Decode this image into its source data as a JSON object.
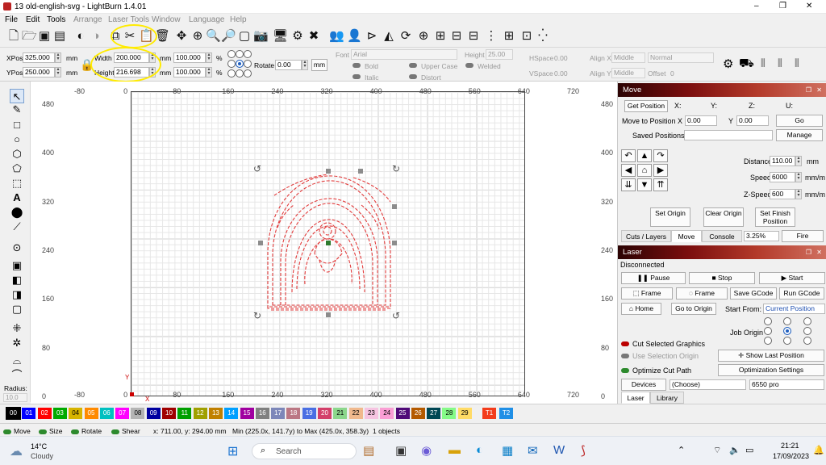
{
  "window": {
    "title": "13 old-english-svg - LightBurn 1.4.01",
    "controls": {
      "min": "–",
      "max": "❐",
      "close": "✕"
    }
  },
  "menu": [
    {
      "label": "File",
      "enabled": true
    },
    {
      "label": "Edit",
      "enabled": true
    },
    {
      "label": "Tools",
      "enabled": true
    },
    {
      "label": "Arrange",
      "enabled": false
    },
    {
      "label": "Laser Tools",
      "enabled": false
    },
    {
      "label": "Window",
      "enabled": false
    },
    {
      "label": "Language",
      "enabled": false
    },
    {
      "label": "Help",
      "enabled": false
    }
  ],
  "props": {
    "xpos_label": "XPos",
    "xpos": "325.000",
    "ypos_label": "YPos",
    "ypos": "250.000",
    "unit": "mm",
    "width_label": "Width",
    "width": "200.000",
    "height_label": "Height",
    "height": "216.698",
    "wpct": "100.000",
    "hpct": "100.000",
    "pct": "%",
    "rotate_label": "Rotate",
    "rotate": "0.00",
    "font_label": "Font",
    "font": "Arial",
    "font_height_label": "Height",
    "font_height": "25.00",
    "hspace_label": "HSpace",
    "hspace": "0.00",
    "vspace_label": "VSpace",
    "vspace": "0.00",
    "alignx_label": "Align X",
    "alignx": "Middle",
    "aligny_label": "Align Y",
    "aligny": "Middle",
    "normal": "Normal",
    "offset_label": "Offset",
    "offset": "0",
    "bold": "Bold",
    "italic": "Italic",
    "upper": "Upper Case",
    "distort": "Distort",
    "welded": "Welded"
  },
  "rulers": {
    "top": [
      "-80",
      "0",
      "80",
      "160",
      "240",
      "320",
      "400",
      "480",
      "560",
      "640",
      "720"
    ],
    "bottom": [
      "-80",
      "0",
      "80",
      "160",
      "240",
      "320",
      "400",
      "480",
      "560",
      "640",
      "720"
    ],
    "left": [
      "480",
      "400",
      "320",
      "240",
      "160",
      "80",
      "0"
    ],
    "right": [
      "480",
      "400",
      "320",
      "240",
      "160",
      "80",
      "0"
    ]
  },
  "left_tools": {
    "radius_label": "Radius:",
    "radius": "10.0"
  },
  "palette": [
    {
      "id": "00",
      "color": "#000000"
    },
    {
      "id": "01",
      "color": "#0000ff"
    },
    {
      "id": "02",
      "color": "#ff0000"
    },
    {
      "id": "03",
      "color": "#00aa00"
    },
    {
      "id": "04",
      "color": "#d7b400"
    },
    {
      "id": "05",
      "color": "#ff8a00"
    },
    {
      "id": "06",
      "color": "#00c0c0"
    },
    {
      "id": "07",
      "color": "#ff00ff"
    },
    {
      "id": "08",
      "color": "#b4b4b4"
    },
    {
      "id": "09",
      "color": "#0000a0"
    },
    {
      "id": "10",
      "color": "#a00000"
    },
    {
      "id": "11",
      "color": "#00a000"
    },
    {
      "id": "12",
      "color": "#a0a000"
    },
    {
      "id": "13",
      "color": "#c08000"
    },
    {
      "id": "14",
      "color": "#00a0ff"
    },
    {
      "id": "15",
      "color": "#a000a0"
    },
    {
      "id": "16",
      "color": "#808080"
    },
    {
      "id": "17",
      "color": "#7d87b9"
    },
    {
      "id": "18",
      "color": "#bb7784"
    },
    {
      "id": "19",
      "color": "#4a6fe3"
    },
    {
      "id": "20",
      "color": "#d33f6a"
    },
    {
      "id": "21",
      "color": "#8cd78c"
    },
    {
      "id": "22",
      "color": "#f0b98d"
    },
    {
      "id": "23",
      "color": "#f6c4e1"
    },
    {
      "id": "24",
      "color": "#fa9ed4"
    },
    {
      "id": "25",
      "color": "#500a78"
    },
    {
      "id": "26",
      "color": "#b45a00"
    },
    {
      "id": "27",
      "color": "#004754"
    },
    {
      "id": "28",
      "color": "#86fa88"
    },
    {
      "id": "29",
      "color": "#ffdb66"
    },
    {
      "id": "T1",
      "color": "#f33c1b"
    },
    {
      "id": "T2",
      "color": "#1f8fe6"
    }
  ],
  "status": {
    "move": "Move",
    "size": "Size",
    "rotate": "Rotate",
    "shear": "Shear",
    "coords": "x: 711.00, y: 294.00 mm",
    "range": "Min (225.0x, 141.7y) to Max (425.0x, 358.3y)",
    "objects": "1 objects"
  },
  "move_panel": {
    "title": "Move",
    "get_position": "Get Position",
    "x": "X:",
    "y": "Y:",
    "z": "Z:",
    "u": "U:",
    "move_to_label": "Move to Position",
    "mx_label": "X",
    "mx": "0.00",
    "my_label": "Y",
    "my": "0.00",
    "go": "Go",
    "saved_label": "Saved Positions:",
    "manage": "Manage",
    "distance_label": "Distance",
    "distance": "110.00",
    "speed_label": "Speed",
    "speed": "6000",
    "zspeed_label": "Z-Speed",
    "zspeed": "600",
    "unit_mm": "mm",
    "unit_mmm": "mm/m",
    "set_origin": "Set Origin",
    "clear_origin": "Clear Origin",
    "set_finish": "Set Finish Position",
    "tabs": [
      "Cuts / Layers",
      "Move",
      "Console"
    ],
    "pct": "3.25%",
    "fire": "Fire"
  },
  "laser_panel": {
    "title": "Laser",
    "state": "Disconnected",
    "pause": "Pause",
    "stop": "Stop",
    "start": "Start",
    "frame1": "Frame",
    "frame2": "Frame",
    "save_gcode": "Save GCode",
    "run_gcode": "Run GCode",
    "home": "Home",
    "goto_origin": "Go to Origin",
    "start_from_label": "Start From:",
    "start_from": "Current Position",
    "job_origin": "Job Origin",
    "cut_selected": "Cut Selected Graphics",
    "use_selection": "Use Selection Origin",
    "show_last": "Show Last Position",
    "optimize": "Optimize Cut Path",
    "opt_settings": "Optimization Settings",
    "devices": "Devices",
    "device_choice": "(Choose)",
    "device_model": "6550 pro",
    "tabs": [
      "Laser",
      "Library"
    ]
  },
  "taskbar": {
    "temp": "14°C",
    "weather": "Cloudy",
    "search": "Search",
    "time": "21:21",
    "date": "17/09/2023"
  },
  "colors": {
    "accent_yellow": "#ffeb00",
    "cut_red": "#e23c3c",
    "header_dark": "#3a0505"
  }
}
